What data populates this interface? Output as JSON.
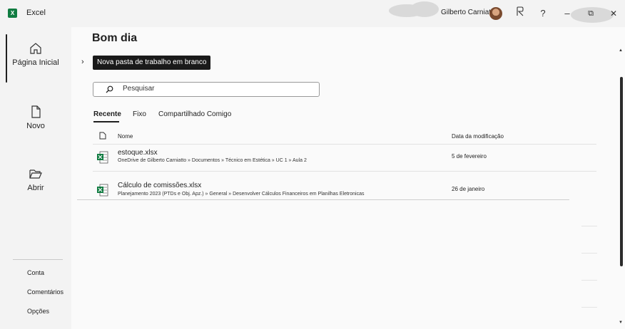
{
  "window": {
    "app_title": "Excel",
    "user_name": "Gilberto Carniatto"
  },
  "titlebar": {
    "help": "?",
    "minimize": "–",
    "restore": "⧉",
    "close": "✕"
  },
  "sidebar": {
    "items": [
      {
        "label": "Página Inicial",
        "icon": "home-icon"
      },
      {
        "label": "Novo",
        "icon": "new-document-icon"
      },
      {
        "label": "Abrir",
        "icon": "folder-open-icon"
      }
    ],
    "bottom": [
      "Conta",
      "Comentários",
      "Opções"
    ]
  },
  "main": {
    "greeting": "Bom dia",
    "blank_workbook": "Nova pasta de trabalho em branco",
    "search_placeholder": "Pesquisar",
    "tabs": [
      "Recente",
      "Fixo",
      "Compartilhado Comigo"
    ],
    "columns": {
      "name": "Nome",
      "modified": "Data da modificação"
    },
    "files": [
      {
        "name": "estoque.xlsx",
        "path": "OneDrive de Gilberto Carniatto » Documentos » Técnico em Estética » UC 1 » Aula 2",
        "date": "5 de fevereiro"
      },
      {
        "name": "Cálculo de comissões.xlsx",
        "path": "Planejamento 2023 (PTDs e Obj. Apz.) » General » Desenvolver Cálculos Financeiros em Planilhas Eletronicas",
        "date": "26 de janeiro"
      }
    ]
  },
  "colors": {
    "accent": "#107c41",
    "sidebar_bg": "#f3f3f3",
    "main_bg": "#fafafa"
  }
}
